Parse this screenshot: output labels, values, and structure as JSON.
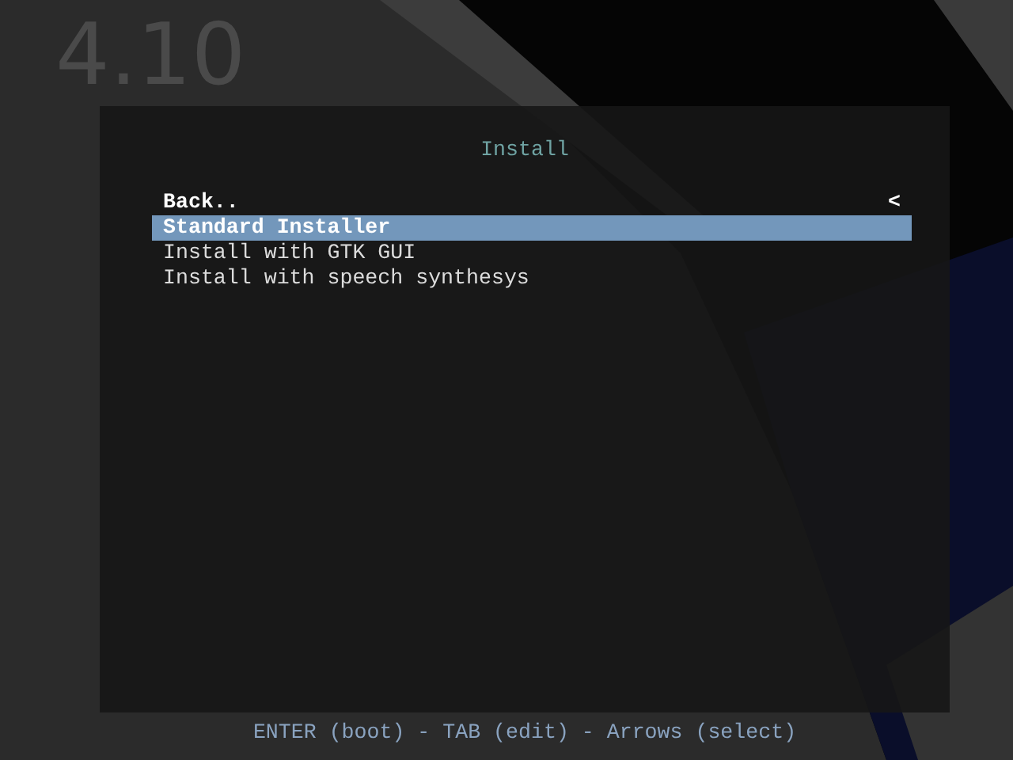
{
  "version": "4.10",
  "menu": {
    "title": "Install",
    "items": [
      {
        "kind": "back",
        "label": "Back..",
        "marker": "<",
        "selected": false
      },
      {
        "kind": "entry",
        "label": "Standard Installer",
        "selected": true
      },
      {
        "kind": "entry",
        "label": "Install with GTK GUI",
        "selected": false
      },
      {
        "kind": "entry",
        "label": "Install with speech synthesys",
        "selected": false
      }
    ]
  },
  "help_line": "ENTER (boot) - TAB (edit) - Arrows (select)"
}
